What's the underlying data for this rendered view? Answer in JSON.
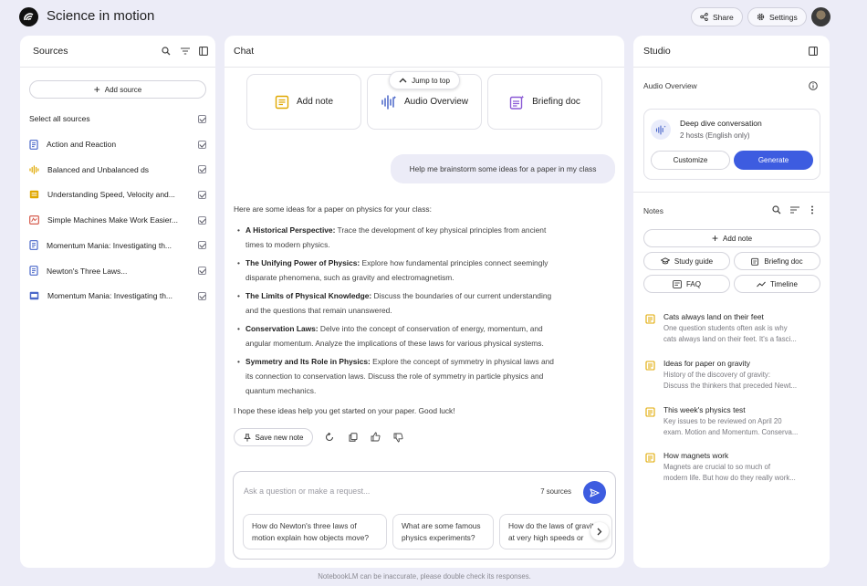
{
  "header": {
    "title": "Science in motion",
    "share_label": "Share",
    "settings_label": "Settings"
  },
  "sources": {
    "title": "Sources",
    "add_label": "Add source",
    "select_all_label": "Select all sources",
    "items": [
      {
        "label": "Action and Reaction",
        "icon": "doc-icon",
        "color": "#4a67c9"
      },
      {
        "label": "Balanced and Unbalanced ds",
        "icon": "audio-icon",
        "color": "#e0a800"
      },
      {
        "label": "Understanding Speed, Velocity and...",
        "icon": "note-icon",
        "color": "#e0a800"
      },
      {
        "label": "Simple Machines Make Work Easier...",
        "icon": "pdf-icon",
        "color": "#d14b3c"
      },
      {
        "label": "Momentum Mania: Investigating th...",
        "icon": "doc-icon",
        "color": "#4a67c9"
      },
      {
        "label": "Newton's Three Laws...",
        "icon": "doc-icon",
        "color": "#4a67c9"
      },
      {
        "label": "Momentum Mania: Investigating th...",
        "icon": "slides-icon",
        "color": "#4a67c9"
      }
    ]
  },
  "chat": {
    "title": "Chat",
    "jump_label": "Jump to top",
    "cards": [
      "Add note",
      "Audio Overview",
      "Briefing doc"
    ],
    "user_message": "Help me brainstorm some ideas for a paper in my class",
    "intro": "Here are some ideas for a paper on physics for your class:",
    "bullets": [
      {
        "title": "A Historical Perspective:",
        "lines": [
          "Trace the development of key physical principles from ancient",
          "times to modern physics."
        ]
      },
      {
        "title": "The Unifying Power of Physics:",
        "lines": [
          "Explore how fundamental principles connect seemingly",
          "disparate phenomena, such as gravity and electromagnetism."
        ]
      },
      {
        "title": "The Limits of Physical Knowledge:",
        "lines": [
          "Discuss the boundaries of our current understanding",
          "and the questions that remain unanswered."
        ]
      },
      {
        "title": "Conservation Laws:",
        "lines": [
          "Delve into the concept of conservation of energy, momentum, and",
          "angular momentum. Analyze the implications of these laws for various physical systems."
        ]
      },
      {
        "title": "Symmetry and Its Role in Physics:",
        "lines": [
          "Explore the concept of symmetry in physical laws and",
          "its connection to conservation laws. Discuss the role of symmetry in particle physics and",
          "quantum mechanics."
        ]
      }
    ],
    "closing": "I hope these ideas help you get started on your paper. Good luck!",
    "save_note_label": "Save new note",
    "input_placeholder": "Ask a question or make a request...",
    "sources_count": "7 sources",
    "suggestions": [
      [
        "How do Newton's three laws of",
        "motion explain how objects move?"
      ],
      [
        "What are some famous",
        "physics experiments?"
      ],
      [
        "How do the laws of gravity",
        "at very high speeds or"
      ]
    ]
  },
  "studio": {
    "title": "Studio",
    "audio_overview_label": "Audio Overview",
    "deep_dive_title": "Deep dive conversation",
    "deep_dive_sub": "2 hosts (English only)",
    "customize_label": "Customize",
    "generate_label": "Generate",
    "notes_label": "Notes",
    "add_note_label": "Add note",
    "quick_actions": [
      "Study guide",
      "Briefing doc",
      "FAQ",
      "Timeline"
    ],
    "notes": [
      {
        "title": "Cats always land on their feet",
        "preview": [
          "One question students often ask is why",
          "cats always land on their feet. It's a fasci..."
        ]
      },
      {
        "title": "Ideas for paper on gravity",
        "preview": [
          "History of the discovery of gravity:",
          "Discuss the thinkers that preceded Newt..."
        ]
      },
      {
        "title": "This week's physics test",
        "preview": [
          "Key issues to be reviewed on April 20",
          "exam. Motion and Momentum. Conserva..."
        ]
      },
      {
        "title": "How magnets work",
        "preview": [
          "Magnets are crucial to so much of",
          "modern life. But how do they really work..."
        ]
      }
    ]
  },
  "footer": {
    "disclaimer": "NotebookLM can be inaccurate, please double check its responses."
  },
  "colors": {
    "background": "#ececf7",
    "accent": "#3d5ce0",
    "note_icon": "#e0a800"
  }
}
